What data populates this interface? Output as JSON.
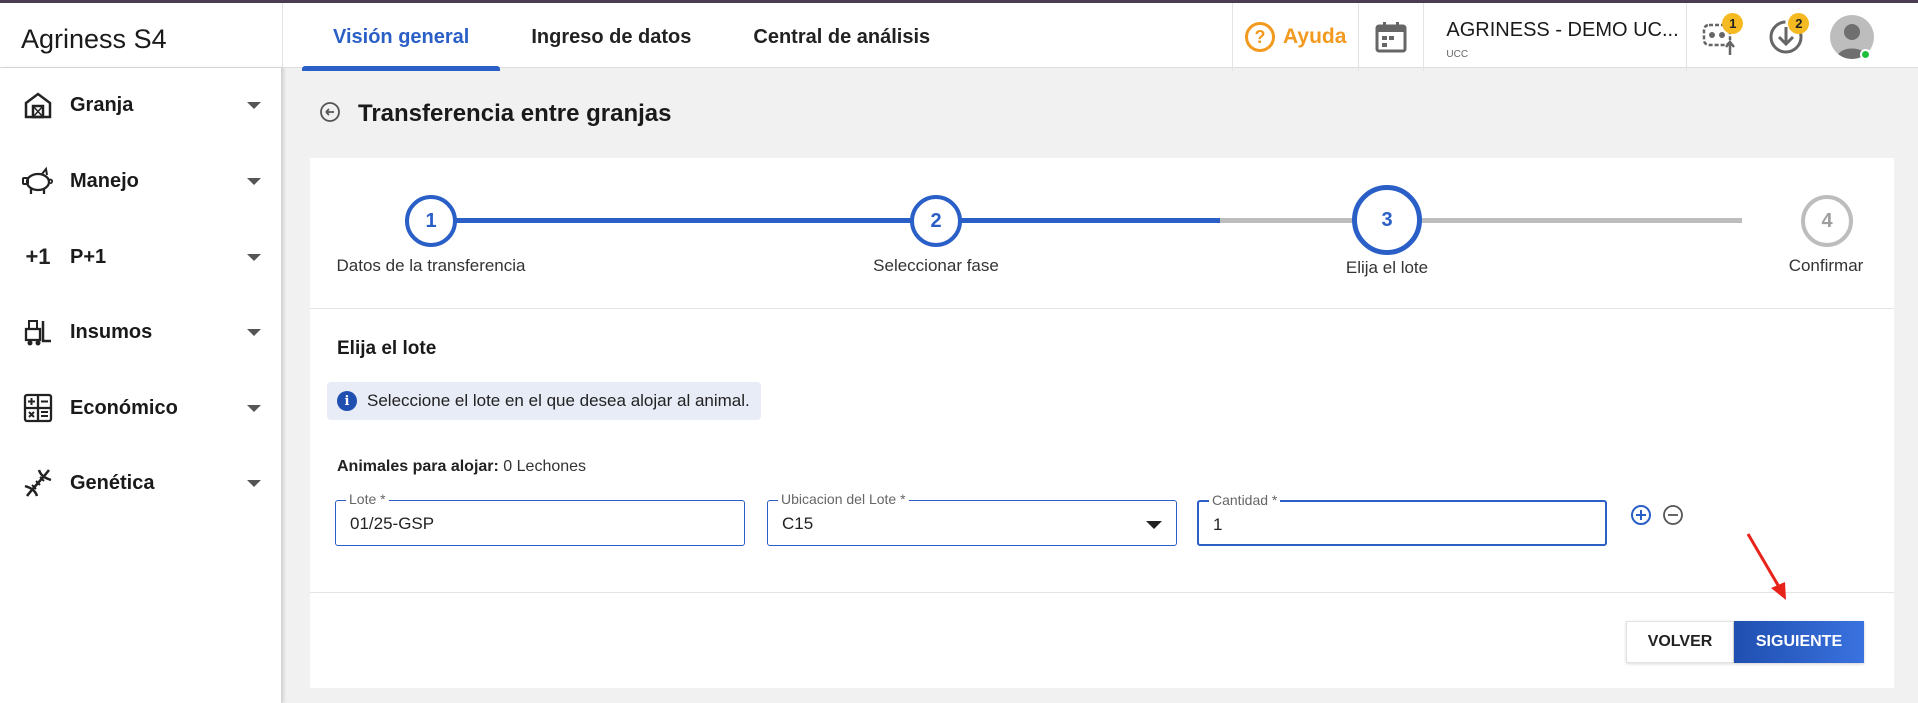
{
  "header": {
    "brand_main": "Agriness",
    "brand_suffix": "S4",
    "tabs": [
      {
        "label": "Visión general",
        "active": true
      },
      {
        "label": "Ingreso de datos",
        "active": false
      },
      {
        "label": "Central de análisis",
        "active": false
      }
    ],
    "help_label": "Ayuda",
    "help_symbol": "?",
    "farm_name": "AGRINESS - DEMO UC...",
    "farm_sub": "UCC",
    "robot_badge": "1",
    "download_badge": "2",
    "icons": [
      "help-icon",
      "calendar-icon",
      "robot-upload-icon",
      "download-icon",
      "user-avatar-icon"
    ]
  },
  "sidebar": {
    "items": [
      {
        "label": "Granja",
        "icon": "barn-icon"
      },
      {
        "label": "Manejo",
        "icon": "pig-icon"
      },
      {
        "label": "P+1",
        "icon": "plus-one-icon"
      },
      {
        "label": "Insumos",
        "icon": "forklift-icon"
      },
      {
        "label": "Económico",
        "icon": "calculator-icon"
      },
      {
        "label": "Genética",
        "icon": "dna-icon"
      }
    ],
    "plus_one_glyph": "+1"
  },
  "page": {
    "title": "Transferencia entre granjas"
  },
  "stepper": {
    "current_step": 3,
    "steps": [
      {
        "number": "1",
        "label": "Datos de la transferencia"
      },
      {
        "number": "2",
        "label": "Seleccionar fase"
      },
      {
        "number": "3",
        "label": "Elija el lote"
      },
      {
        "number": "4",
        "label": "Confirmar"
      }
    ]
  },
  "form": {
    "section_title": "Elija el lote",
    "info_icon": "i",
    "info_text": "Seleccione el lote en el que desea alojar al animal.",
    "animals_label": "Animales para alojar:",
    "animals_value": "0 Lechones",
    "lote_label": "Lote *",
    "lote_value": "01/25-GSP",
    "ubicacion_label": "Ubicacion del Lote *",
    "ubicacion_value": "C15",
    "cantidad_label": "Cantidad *",
    "cantidad_value": "1"
  },
  "footer": {
    "back_label": "VOLVER",
    "next_label": "SIGUIENTE"
  },
  "colors": {
    "accent": "#2a5fc7",
    "help": "#f29a1f",
    "badge": "#f5b921",
    "annotation_arrow": "#e8231b"
  }
}
